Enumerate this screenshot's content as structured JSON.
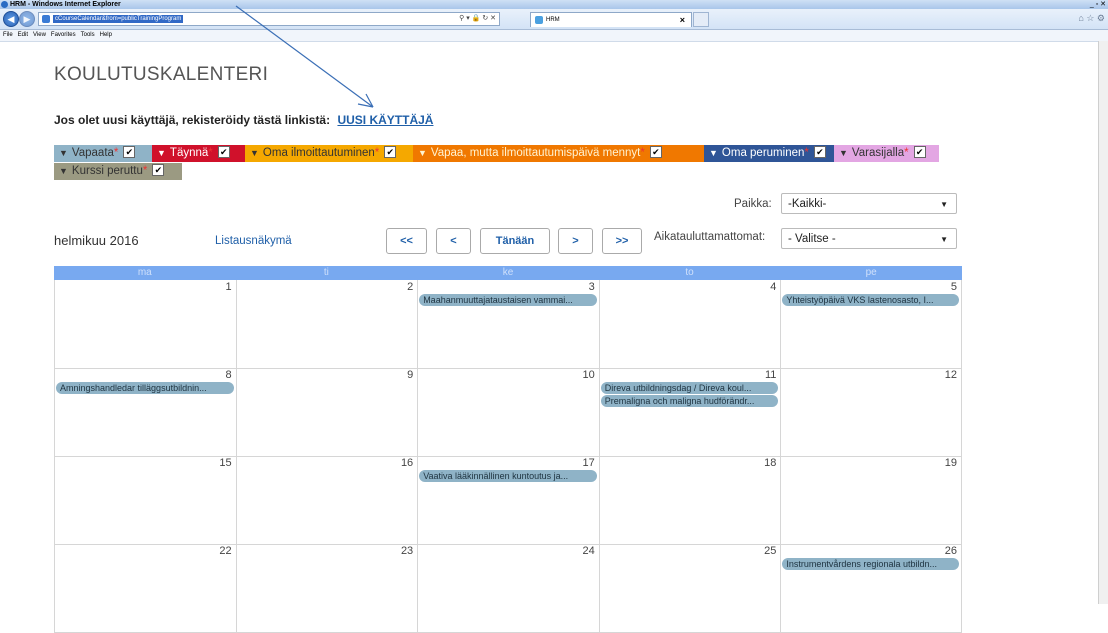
{
  "browser": {
    "title": "HRM - Windows Internet Explorer",
    "url_selected": "cCourseCalendar&from=publicTrainingProgram",
    "tab_title": "HRM",
    "menu": [
      "File",
      "Edit",
      "View",
      "Favorites",
      "Tools",
      "Help"
    ]
  },
  "page": {
    "title": "KOULUTUSKALENTERI",
    "register_text": "Jos olet uusi käyttäjä, rekisteröidy tästä linkistä:",
    "register_link": "UUSI KÄYTTÄJÄ"
  },
  "legend": [
    {
      "label": "Vapaata",
      "bg": "#8fb3c7",
      "color": "#333"
    },
    {
      "label": "Täynnä",
      "bg": "#d0112b",
      "color": "#ffffff"
    },
    {
      "label": "Oma ilmoittautuminen",
      "bg": "#f5a800",
      "color": "#333"
    },
    {
      "label": "Vapaa, mutta ilmoittautumispäivä mennyt",
      "bg": "#f07800",
      "color": "#fff3d0"
    },
    {
      "label": "Oma peruminen",
      "bg": "#2f5597",
      "color": "#ffffff"
    },
    {
      "label": "Varasijalla",
      "bg": "#e3a6e3",
      "color": "#333"
    },
    {
      "label": "Kurssi peruttu",
      "bg": "#9b9a82",
      "color": "#333"
    }
  ],
  "filters": {
    "place_label": "Paikka:",
    "place_value": "-Kaikki-",
    "unscheduled_label": "Aikatauluttamattomat:",
    "unscheduled_value": "- Valitse -"
  },
  "toolbar": {
    "month": "helmikuu 2016",
    "list_view": "Listausnäkymä",
    "first": "<<",
    "prev": "<",
    "today": "Tänään",
    "next": ">",
    "last": ">>"
  },
  "calendar": {
    "days": [
      "ma",
      "ti",
      "ke",
      "to",
      "pe"
    ],
    "weeks": [
      {
        "dates": [
          "1",
          "2",
          "3",
          "4",
          "5"
        ],
        "events": [
          [],
          [],
          [
            "Maahanmuuttajataustaisen vammai..."
          ],
          [],
          [
            "Yhteistyöpäivä VKS lastenosasto, I..."
          ]
        ]
      },
      {
        "dates": [
          "8",
          "9",
          "10",
          "11",
          "12"
        ],
        "events": [
          [
            "Amningshandledar tilläggsutbildnin..."
          ],
          [],
          [],
          [
            "Direva utbildningsdag / Direva koul...",
            "Premaligna och maligna hudförändr..."
          ],
          []
        ]
      },
      {
        "dates": [
          "15",
          "16",
          "17",
          "18",
          "19"
        ],
        "events": [
          [],
          [],
          [
            "Vaativa lääkinnällinen kuntoutus ja..."
          ],
          [],
          []
        ]
      },
      {
        "dates": [
          "22",
          "23",
          "24",
          "25",
          "26"
        ],
        "events": [
          [],
          [],
          [],
          [],
          [
            "Instrumentvårdens regionala utbildn..."
          ]
        ]
      }
    ]
  }
}
